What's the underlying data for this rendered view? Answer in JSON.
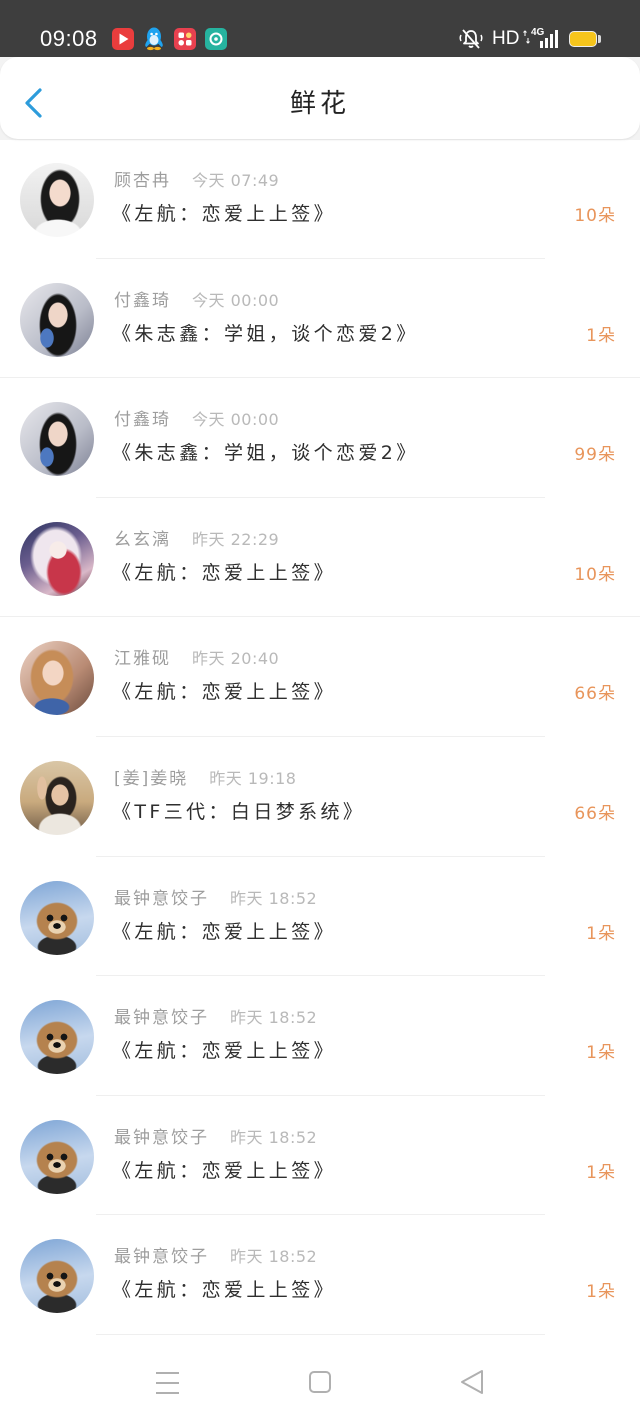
{
  "status_bar": {
    "time": "09:08",
    "network_label": "HD",
    "cellular_label": "4G",
    "icons": [
      "video-app-icon",
      "qq-icon",
      "gallery-app-icon",
      "teal-app-icon",
      "mute-icon",
      "data-arrows-icon",
      "signal-icon",
      "battery-icon"
    ],
    "colors": {
      "background": "#3e3e3e",
      "battery": "#f6c51c"
    }
  },
  "header": {
    "title": "鲜花",
    "back_icon": "chevron-left-icon",
    "accent_color": "#2d9cdb"
  },
  "flower_list": {
    "count_color": "#e8955b",
    "items": [
      {
        "name": "顾杏冉",
        "time": "今天 07:49",
        "book": "《左航：恋爱上上签》",
        "flowers": "10朵"
      },
      {
        "name": "付鑫琦",
        "time": "今天 00:00",
        "book": "《朱志鑫：学姐，谈个恋爱2》",
        "flowers": "1朵"
      },
      {
        "name": "付鑫琦",
        "time": "今天 00:00",
        "book": "《朱志鑫：学姐，谈个恋爱2》",
        "flowers": "99朵"
      },
      {
        "name": "幺玄漓",
        "time": "昨天 22:29",
        "book": "《左航：恋爱上上签》",
        "flowers": "10朵"
      },
      {
        "name": "江雅砚",
        "time": "昨天 20:40",
        "book": "《左航：恋爱上上签》",
        "flowers": "66朵"
      },
      {
        "name": "[姜]姜晓",
        "time": "昨天 19:18",
        "book": "《TF三代：白日梦系统》",
        "flowers": "66朵"
      },
      {
        "name": "最钟意饺子",
        "time": "昨天 18:52",
        "book": "《左航：恋爱上上签》",
        "flowers": "1朵"
      },
      {
        "name": "最钟意饺子",
        "time": "昨天 18:52",
        "book": "《左航：恋爱上上签》",
        "flowers": "1朵"
      },
      {
        "name": "最钟意饺子",
        "time": "昨天 18:52",
        "book": "《左航：恋爱上上签》",
        "flowers": "1朵"
      },
      {
        "name": "最钟意饺子",
        "time": "昨天 18:52",
        "book": "《左航：恋爱上上签》",
        "flowers": "1朵"
      }
    ]
  },
  "nav_bar": {
    "icons": [
      "menu-icon",
      "home-icon",
      "back-triangle-icon"
    ],
    "icon_color": "#b0b0b0"
  }
}
